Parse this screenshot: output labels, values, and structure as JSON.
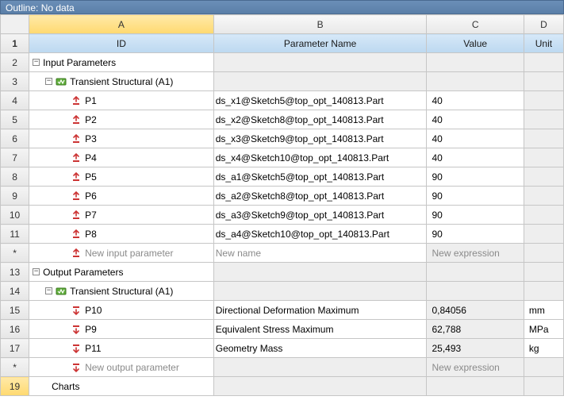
{
  "title": "Outline: No data",
  "columns": {
    "letters": [
      "A",
      "B",
      "C",
      "D"
    ],
    "headers": [
      "ID",
      "Parameter Name",
      "Value",
      "Unit"
    ]
  },
  "rows": [
    {
      "n": "2",
      "type": "group",
      "expand": "-",
      "label": "Input Parameters"
    },
    {
      "n": "3",
      "type": "system",
      "expand": "-",
      "label": "Transient Structural (A1)"
    },
    {
      "n": "4",
      "type": "in",
      "id": "P1",
      "name": "ds_x1@Sketch5@top_opt_140813.Part",
      "value": "40",
      "unit": ""
    },
    {
      "n": "5",
      "type": "in",
      "id": "P2",
      "name": "ds_x2@Sketch8@top_opt_140813.Part",
      "value": "40",
      "unit": ""
    },
    {
      "n": "6",
      "type": "in",
      "id": "P3",
      "name": "ds_x3@Sketch9@top_opt_140813.Part",
      "value": "40",
      "unit": ""
    },
    {
      "n": "7",
      "type": "in",
      "id": "P4",
      "name": "ds_x4@Sketch10@top_opt_140813.Part",
      "value": "40",
      "unit": ""
    },
    {
      "n": "8",
      "type": "in",
      "id": "P5",
      "name": "ds_a1@Sketch5@top_opt_140813.Part",
      "value": "90",
      "unit": ""
    },
    {
      "n": "9",
      "type": "in",
      "id": "P6",
      "name": "ds_a2@Sketch8@top_opt_140813.Part",
      "value": "90",
      "unit": ""
    },
    {
      "n": "10",
      "type": "in",
      "id": "P7",
      "name": "ds_a3@Sketch9@top_opt_140813.Part",
      "value": "90",
      "unit": ""
    },
    {
      "n": "11",
      "type": "in",
      "id": "P8",
      "name": "ds_a4@Sketch10@top_opt_140813.Part",
      "value": "90",
      "unit": ""
    },
    {
      "n": "*",
      "type": "new-in",
      "id": "New input parameter",
      "name": "New name",
      "value": "New expression",
      "unit": ""
    },
    {
      "n": "13",
      "type": "group",
      "expand": "-",
      "label": "Output Parameters"
    },
    {
      "n": "14",
      "type": "system",
      "expand": "-",
      "label": "Transient Structural (A1)"
    },
    {
      "n": "15",
      "type": "out",
      "id": "P10",
      "name": "Directional Deformation Maximum",
      "value": "0,84056",
      "unit": "mm"
    },
    {
      "n": "16",
      "type": "out",
      "id": "P9",
      "name": "Equivalent Stress Maximum",
      "value": "62,788",
      "unit": "MPa"
    },
    {
      "n": "17",
      "type": "out",
      "id": "P11",
      "name": "Geometry Mass",
      "value": "25,493",
      "unit": "kg"
    },
    {
      "n": "*",
      "type": "new-out",
      "id": "New output parameter",
      "name": "",
      "value": "New expression",
      "unit": ""
    },
    {
      "n": "19",
      "type": "charts",
      "label": "Charts"
    }
  ]
}
